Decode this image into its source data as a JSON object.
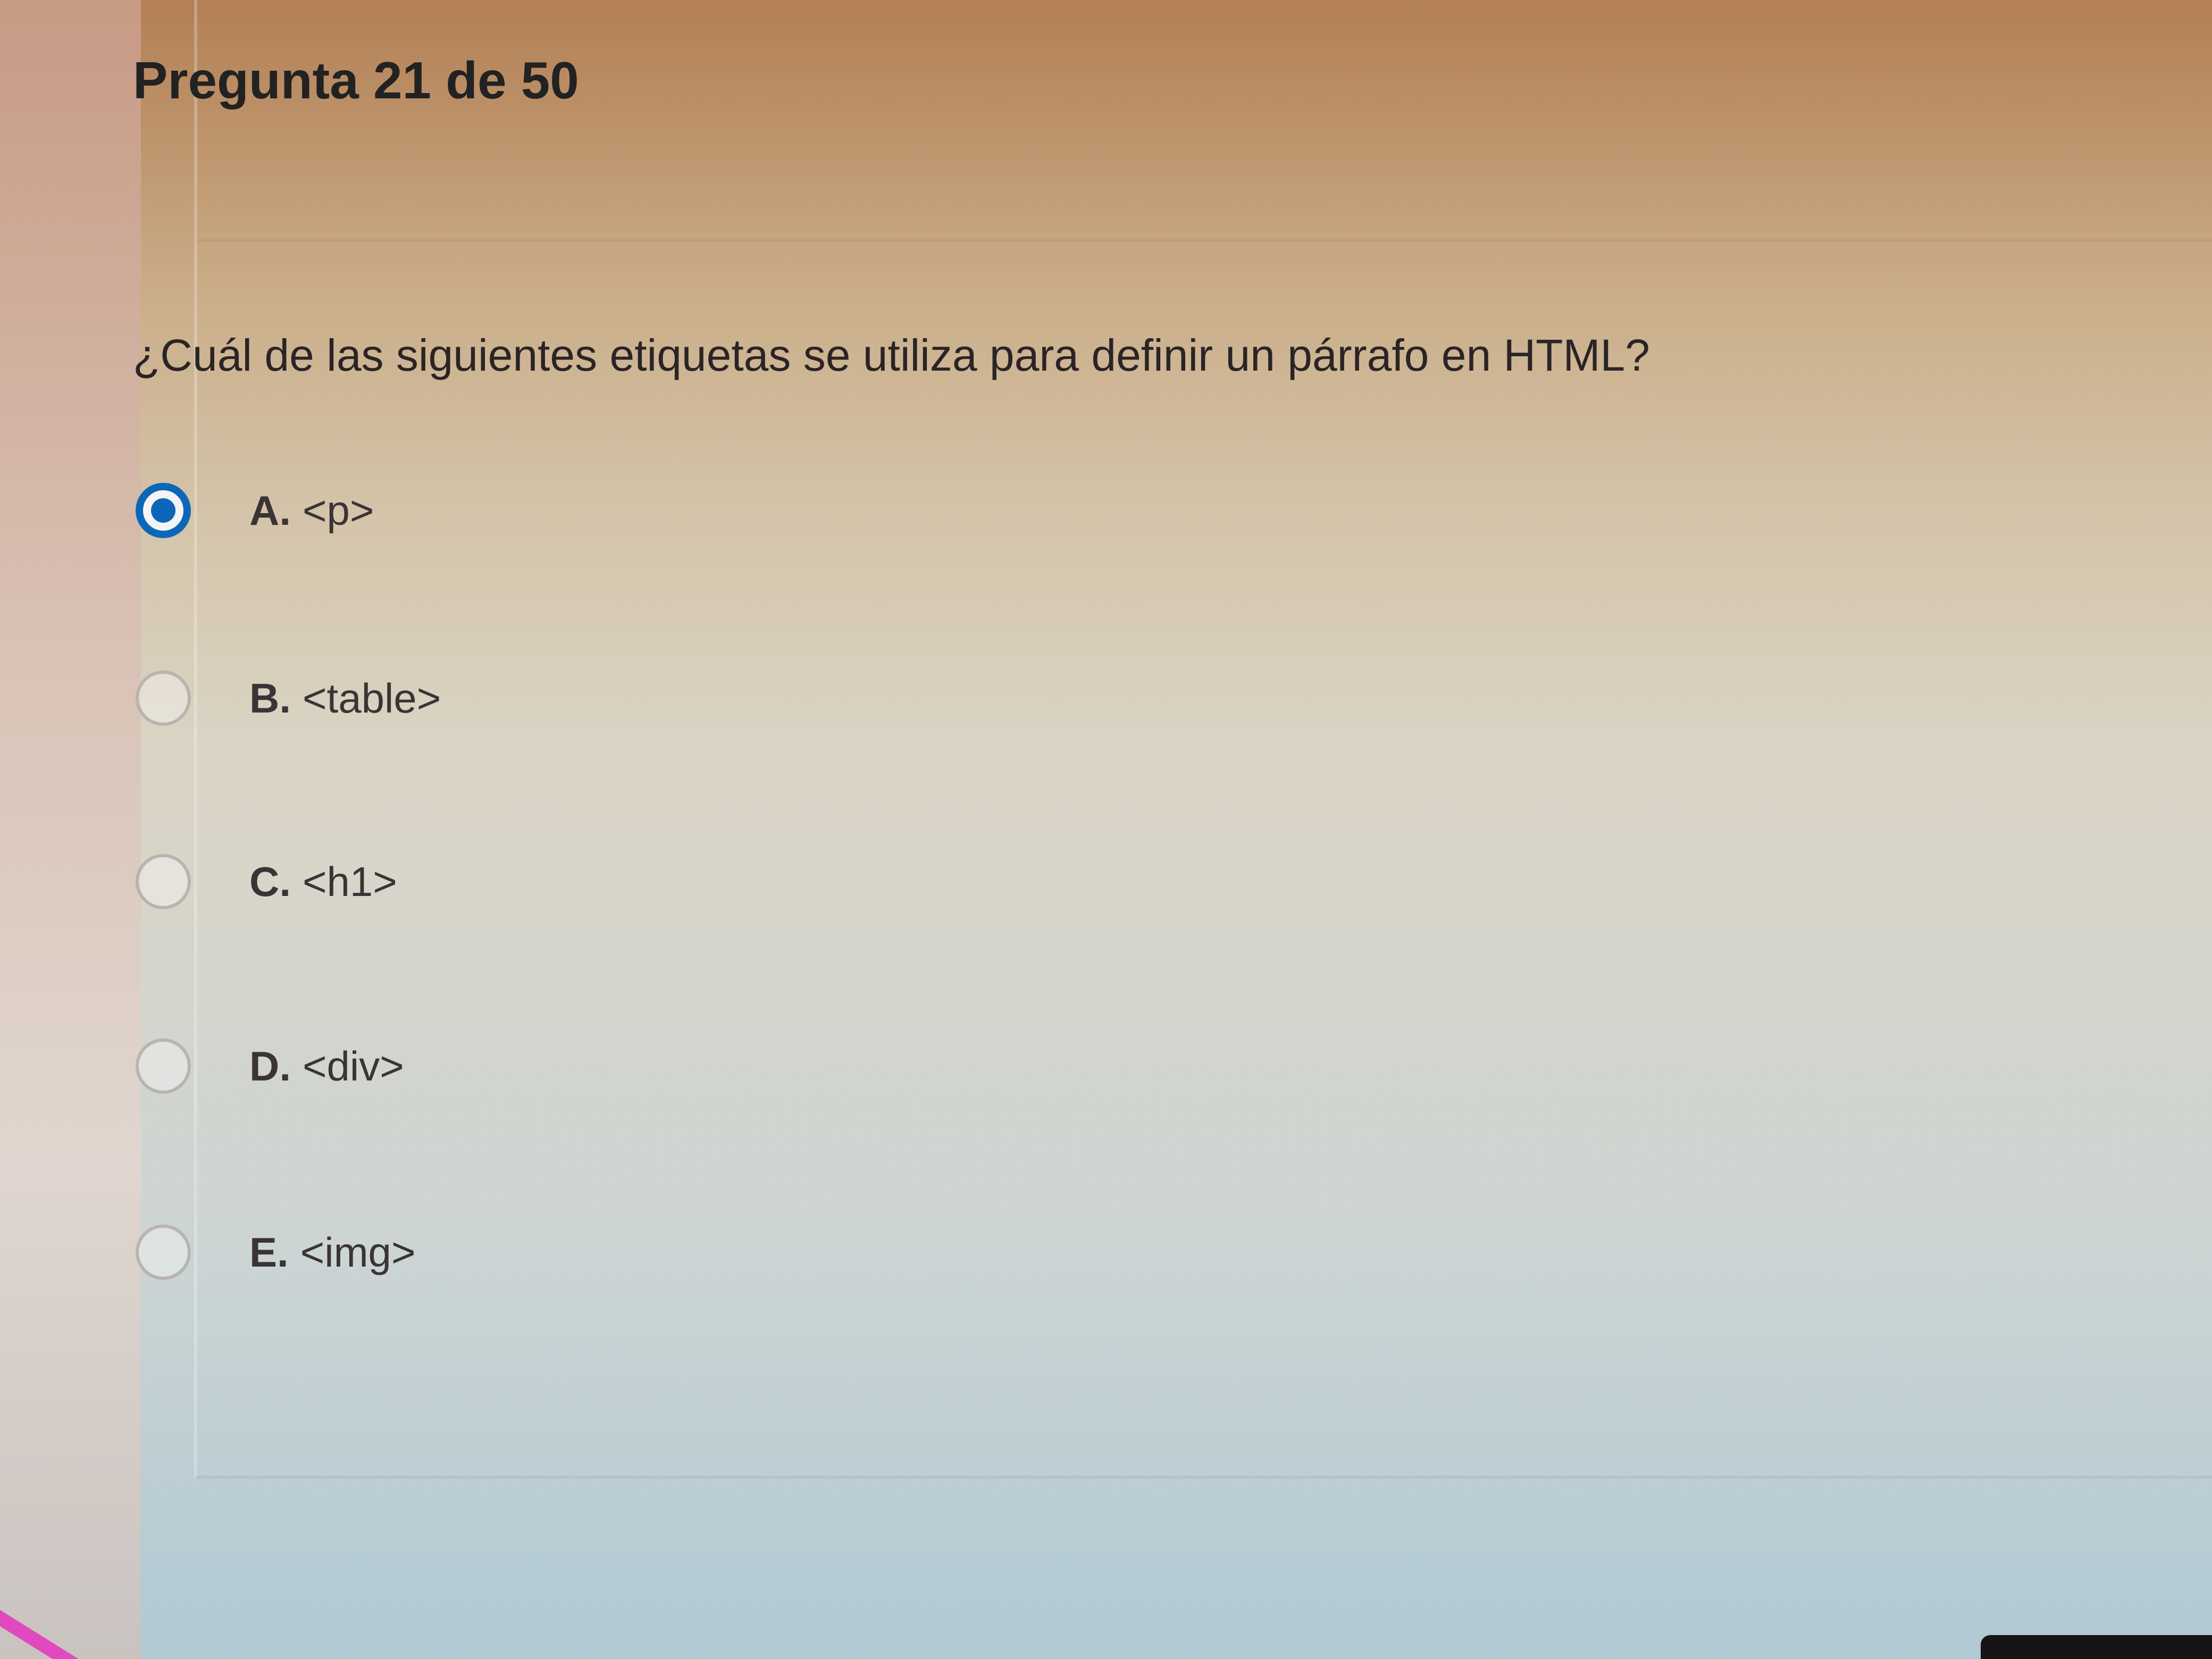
{
  "quiz": {
    "question_number": "Pregunta 21 de 50",
    "question_text": "¿Cuál de las siguientes etiquetas se utiliza para definir un párrafo en HTML?",
    "selected_option": "A",
    "options": [
      {
        "letter": "A.",
        "text": "<p>"
      },
      {
        "letter": "B.",
        "text": "<table>"
      },
      {
        "letter": "C.",
        "text": "<h1>"
      },
      {
        "letter": "D.",
        "text": "<div>"
      },
      {
        "letter": "E.",
        "text": "<img>"
      }
    ]
  },
  "colors": {
    "accent": "#0c67b8",
    "text": "#222222",
    "radio_border": "#b8b4b0"
  }
}
